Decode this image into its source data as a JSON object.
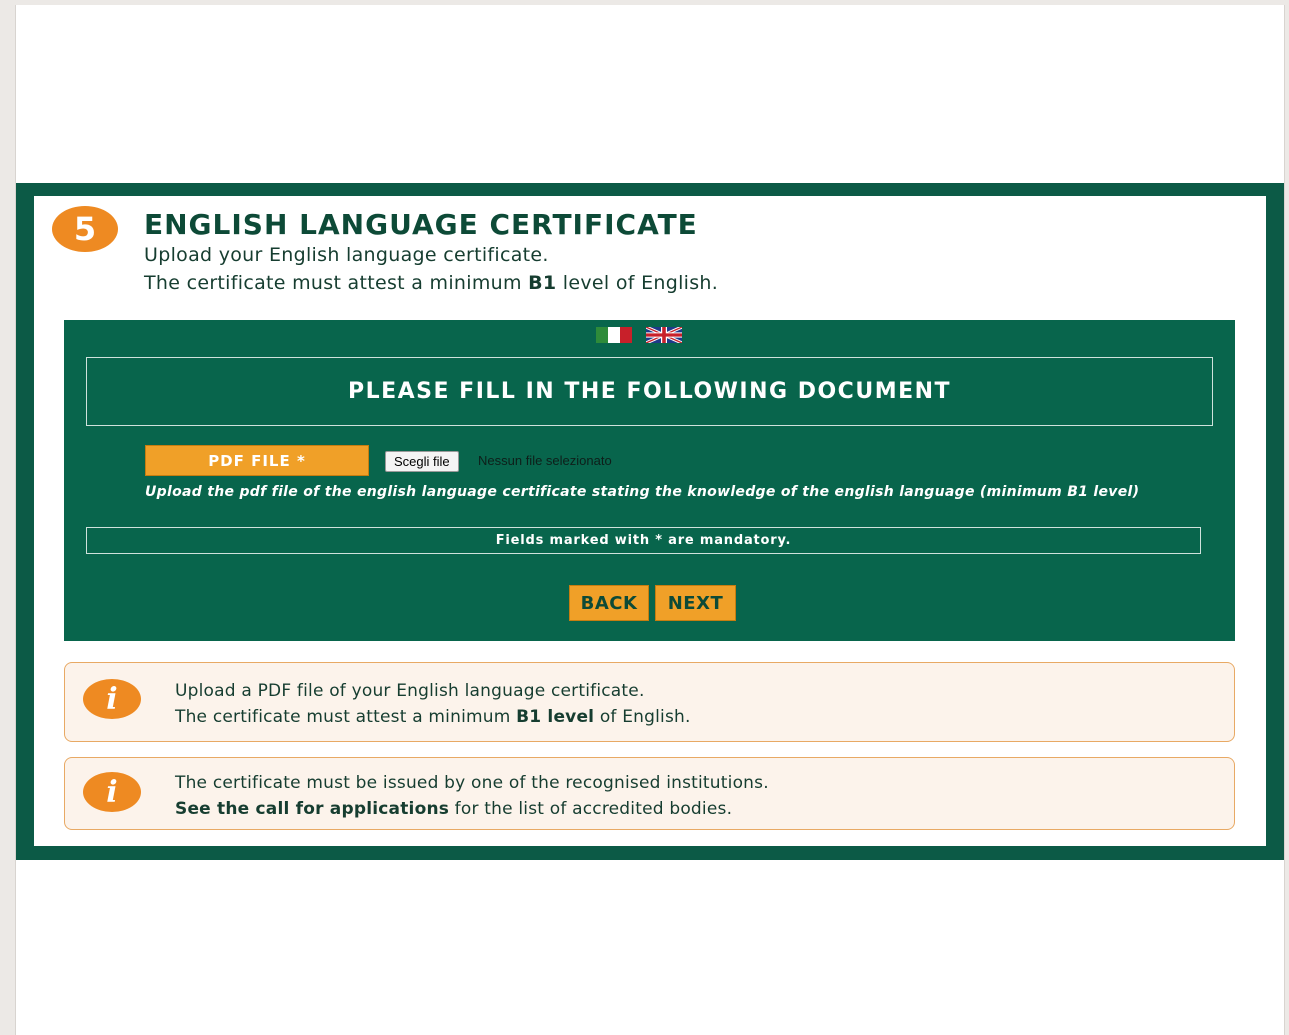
{
  "step": {
    "number": "5",
    "title": "ENGLISH LANGUAGE CERTIFICATE"
  },
  "intro": {
    "line1": "Upload your English language certificate.",
    "line2_pre": "The certificate must attest a minimum ",
    "line2_bold": "B1",
    "line2_post": " level of English."
  },
  "languages": [
    {
      "name": "italian-flag-icon"
    },
    {
      "name": "uk-flag-icon"
    }
  ],
  "form": {
    "heading": "PLEASE FILL IN THE FOLLOWING DOCUMENT",
    "file_label": "PDF FILE *",
    "choose_button": "Scegli file",
    "file_status": "Nessun file selezionato",
    "hint": "Upload the pdf file of the english language certificate stating the knowledge of the english language (minimum B1 level)",
    "mandatory_note": "Fields marked with * are mandatory.",
    "back_label": "BACK",
    "next_label": "NEXT"
  },
  "info_boxes": [
    {
      "icon": "info-icon",
      "line1": "Upload a PDF file of your English language certificate.",
      "line2_pre": "The certificate must attest a minimum ",
      "line2_bold": "B1 level",
      "line2_post": " of English."
    },
    {
      "icon": "info-icon",
      "line1": "The certificate must be issued by one of the recognised institutions.",
      "line2_bold": "See the call for applications",
      "line2_post": " for the list of accredited bodies."
    }
  ],
  "colors": {
    "primary_green": "#08654c",
    "frame_green": "#0c5a46",
    "accent_orange": "#ee8a22",
    "button_orange": "#f0a028",
    "info_background": "#fcf3eb"
  }
}
